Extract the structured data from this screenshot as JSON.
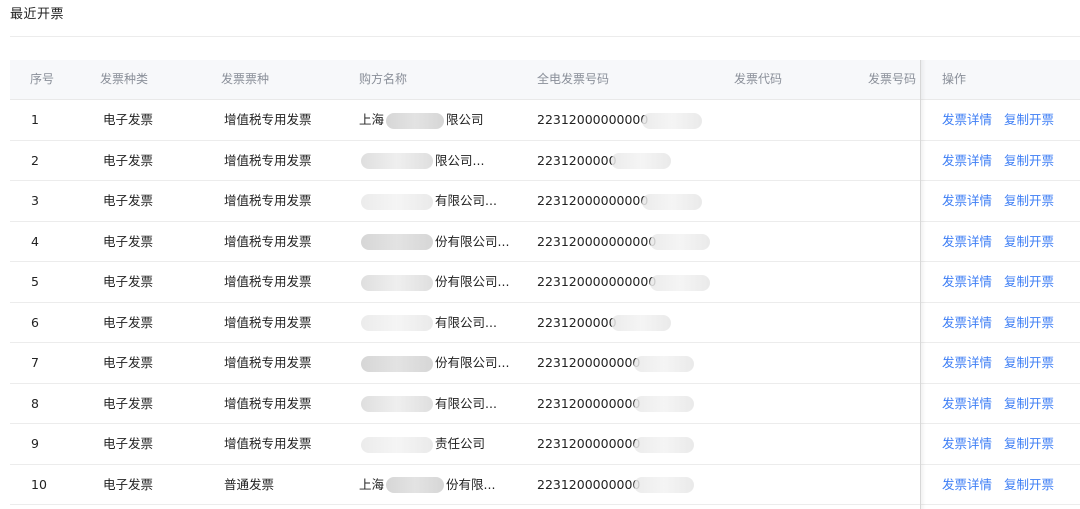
{
  "page": {
    "title": "最近开票"
  },
  "table": {
    "columns": [
      {
        "key": "index",
        "label": "序号"
      },
      {
        "key": "invoice_type",
        "label": "发票种类"
      },
      {
        "key": "ticket_kind",
        "label": "发票票种"
      },
      {
        "key": "buyer",
        "label": "购方名称"
      },
      {
        "key": "full_number",
        "label": "全电发票号码"
      },
      {
        "key": "code",
        "label": "发票代码"
      },
      {
        "key": "number",
        "label": "发票号码"
      },
      {
        "key": "actions",
        "label": "操作"
      }
    ],
    "rows": [
      {
        "index": "1",
        "invoice_type": "电子发票",
        "ticket_kind": "增值税专用发票",
        "buyer_prefix": "上海",
        "buyer_suffix": "限公司",
        "full_number": "22312000000000",
        "code": "",
        "number": ""
      },
      {
        "index": "2",
        "invoice_type": "电子发票",
        "ticket_kind": "增值税专用发票",
        "buyer_prefix": "",
        "buyer_suffix": "限公司...",
        "full_number": "2231200000",
        "code": "",
        "number": ""
      },
      {
        "index": "3",
        "invoice_type": "电子发票",
        "ticket_kind": "增值税专用发票",
        "buyer_prefix": "",
        "buyer_suffix": "有限公司...",
        "full_number": "22312000000000",
        "code": "",
        "number": ""
      },
      {
        "index": "4",
        "invoice_type": "电子发票",
        "ticket_kind": "增值税专用发票",
        "buyer_prefix": "",
        "buyer_suffix": "份有限公司...",
        "full_number": "223120000000000",
        "code": "",
        "number": ""
      },
      {
        "index": "5",
        "invoice_type": "电子发票",
        "ticket_kind": "增值税专用发票",
        "buyer_prefix": "",
        "buyer_suffix": "份有限公司...",
        "full_number": "223120000000000",
        "code": "",
        "number": ""
      },
      {
        "index": "6",
        "invoice_type": "电子发票",
        "ticket_kind": "增值税专用发票",
        "buyer_prefix": "",
        "buyer_suffix": "有限公司...",
        "full_number": "2231200000",
        "code": "",
        "number": ""
      },
      {
        "index": "7",
        "invoice_type": "电子发票",
        "ticket_kind": "增值税专用发票",
        "buyer_prefix": "",
        "buyer_suffix": "份有限公司...",
        "full_number": "2231200000000",
        "code": "",
        "number": ""
      },
      {
        "index": "8",
        "invoice_type": "电子发票",
        "ticket_kind": "增值税专用发票",
        "buyer_prefix": "",
        "buyer_suffix": "有限公司...",
        "full_number": "2231200000000",
        "code": "",
        "number": ""
      },
      {
        "index": "9",
        "invoice_type": "电子发票",
        "ticket_kind": "增值税专用发票",
        "buyer_prefix": "",
        "buyer_suffix": "责任公司",
        "full_number": "2231200000000",
        "code": "",
        "number": ""
      },
      {
        "index": "10",
        "invoice_type": "电子发票",
        "ticket_kind": "普通发票",
        "buyer_prefix": "上海",
        "buyer_suffix": "份有限...",
        "full_number": "2231200000000",
        "code": "",
        "number": ""
      }
    ],
    "actions": {
      "detail_label": "发票详情",
      "copy_label": "复制开票"
    }
  },
  "colors": {
    "link": "#3d7ef5",
    "header_bg": "#f7f8fa",
    "header_text": "#8a8f99"
  }
}
